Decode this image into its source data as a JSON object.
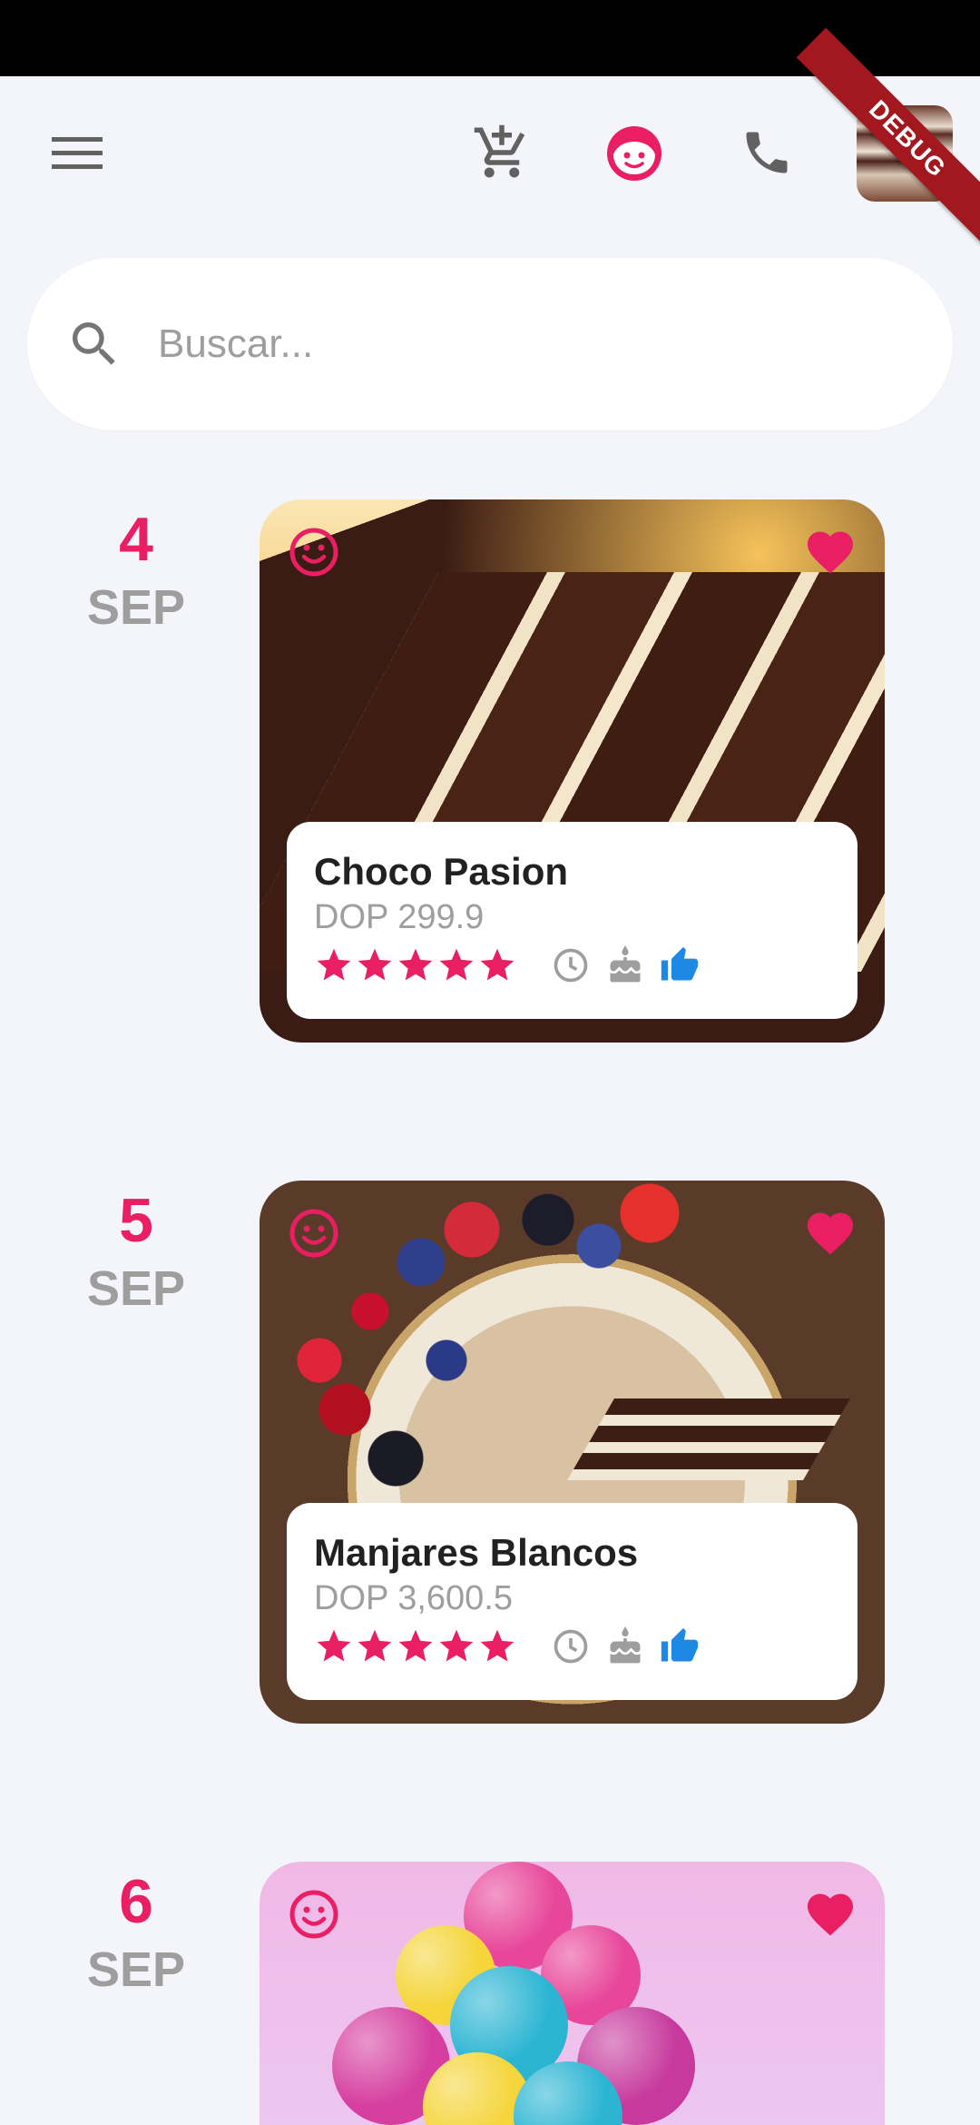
{
  "app": {
    "debug_banner": "DEBUG"
  },
  "search": {
    "placeholder": "Buscar..."
  },
  "colors": {
    "accent": "#e91e63",
    "muted": "#9e9e9e",
    "like": "#1e88e5"
  },
  "icons": {
    "menu": "menu-icon",
    "cart": "add-to-cart-icon",
    "profile": "face-icon",
    "phone": "phone-icon",
    "search": "search-icon",
    "smile": "smile-icon",
    "favorite": "heart-icon",
    "star": "star-icon",
    "time": "clock-icon",
    "cake": "cake-icon",
    "like": "thumbs-up-icon"
  },
  "entries": [
    {
      "day": "4",
      "month": "SEP",
      "name": "Choco Pasion",
      "price": "DOP 299.9",
      "rating": 5
    },
    {
      "day": "5",
      "month": "SEP",
      "name": "Manjares Blancos",
      "price": "DOP 3,600.5",
      "rating": 5
    },
    {
      "day": "6",
      "month": "SEP"
    }
  ]
}
